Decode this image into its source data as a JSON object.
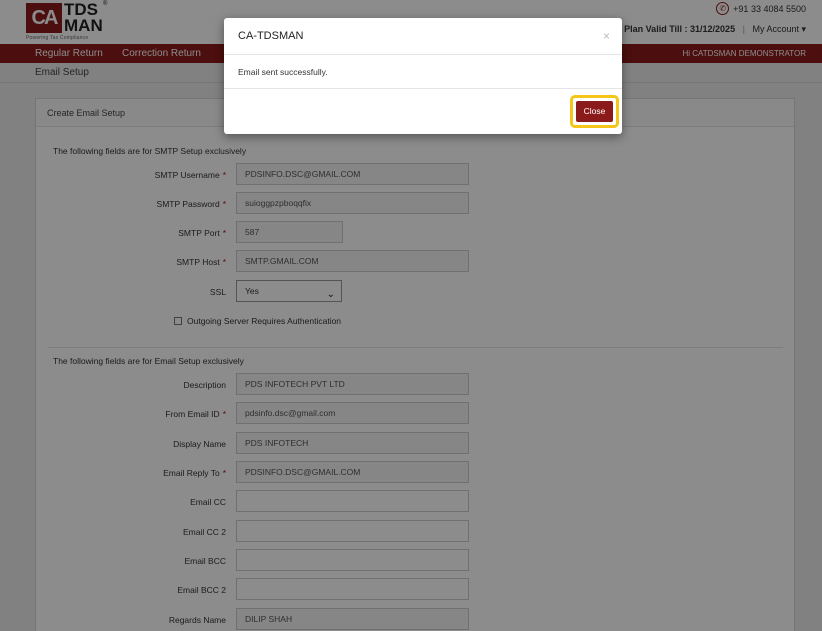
{
  "header": {
    "logo_ca": "CA",
    "logo_tds": "TDS",
    "logo_man": "MAN",
    "logo_reg": "®",
    "logo_tagline": "Powering Tax Compliance",
    "phone": "+91 33 4084 5500",
    "plan_label": "Plan Valid Till : 31/12/2025",
    "separator": "|",
    "account": "My Account ▾"
  },
  "nav": {
    "items": [
      "Regular Return",
      "Correction Return"
    ],
    "user": "Hi CATDSMAN DEMONSTRATOR"
  },
  "breadcrumb": "Email Setup",
  "card": {
    "title": "Create Email Setup",
    "smtp_section": "The following fields are for SMTP Setup exclusively",
    "email_section": "The following fields are for Email Setup exclusively",
    "smtp_username_label": "SMTP Username",
    "smtp_username": "PDSINFO.DSC@GMAIL.COM",
    "smtp_password_label": "SMTP Password",
    "smtp_password": "suioggpzpboqqfix",
    "smtp_port_label": "SMTP Port",
    "smtp_port": "587",
    "smtp_host_label": "SMTP Host",
    "smtp_host": "SMTP.GMAIL.COM",
    "ssl_label": "SSL",
    "ssl_value": "Yes",
    "auth_label": "Outgoing Server Requires Authentication",
    "description_label": "Description",
    "description": "PDS INFOTECH PVT LTD",
    "from_label": "From Email ID",
    "from": "pdsinfo.dsc@gmail.com",
    "display_label": "Display Name",
    "display": "PDS INFOTECH",
    "reply_label": "Email Reply To",
    "reply": "PDSINFO.DSC@GMAIL.COM",
    "cc_label": "Email CC",
    "cc2_label": "Email CC 2",
    "bcc_label": "Email BCC",
    "bcc2_label": "Email BCC 2",
    "regards_label": "Regards Name",
    "regards": "DILIP SHAH",
    "required_mark": "*"
  },
  "modal": {
    "title": "CA-TDSMAN",
    "close_x": "×",
    "message": "Email sent successfully.",
    "close_label": "Close"
  },
  "colors": {
    "brand": "#8b1a1a",
    "highlight": "#f5c518"
  }
}
